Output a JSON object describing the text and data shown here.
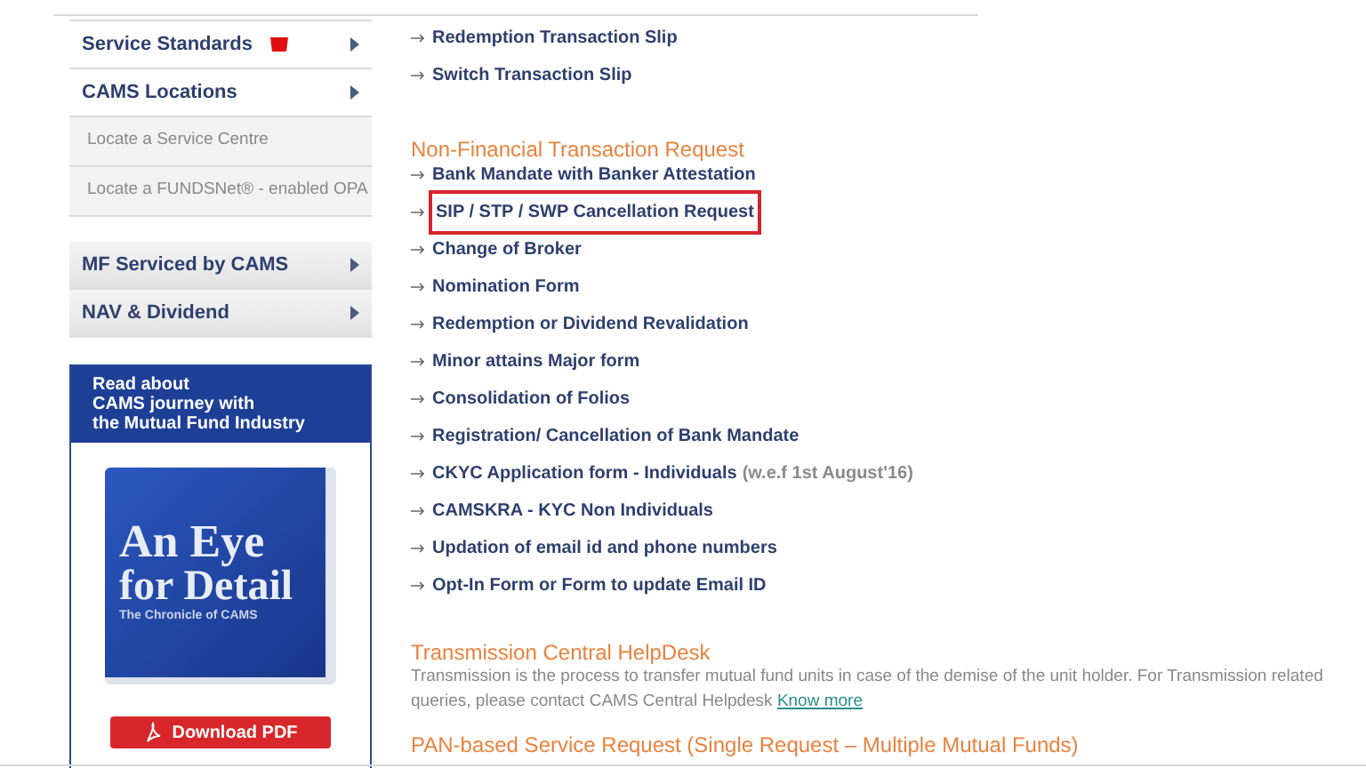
{
  "sidebar": {
    "menu": [
      {
        "label": "Service Standards",
        "kind": "main",
        "flag": true
      },
      {
        "label": "CAMS Locations",
        "kind": "main",
        "flag": false,
        "children": [
          {
            "label": "Locate a Service Centre"
          },
          {
            "label": "Locate a FUNDSNet® - enabled OPA"
          }
        ]
      }
    ],
    "menu2": [
      {
        "label": "MF Serviced by CAMS",
        "kind": "shaded",
        "flag": false
      },
      {
        "label": "NAV & Dividend",
        "kind": "shaded",
        "flag": false
      }
    ],
    "promo": {
      "headline": "Read about\nCAMS journey with\nthe Mutual Fund Industry",
      "book_title_1": "An Eye",
      "book_title_2": "for Detail",
      "book_subtitle": "The Chronicle of CAMS",
      "download": "Download PDF"
    }
  },
  "content": {
    "links_top": [
      {
        "label": "Redemption Transaction Slip",
        "highlighted": false
      },
      {
        "label": "Switch Transaction Slip",
        "highlighted": false
      }
    ],
    "section": {
      "heading": "Non-Financial Transaction Request",
      "links": [
        {
          "label": "Bank Mandate with Banker Attestation",
          "highlighted": false
        },
        {
          "label": "SIP / STP / SWP Cancellation Request",
          "highlighted": true
        },
        {
          "label": "Change of Broker",
          "highlighted": false
        },
        {
          "label": "Nomination Form",
          "highlighted": false
        },
        {
          "label": "Redemption or Dividend Revalidation",
          "highlighted": false
        },
        {
          "label": "Minor attains Major form",
          "highlighted": false
        },
        {
          "label": "Consolidation of Folios",
          "highlighted": false
        },
        {
          "label": "Registration/ Cancellation of Bank Mandate",
          "highlighted": false
        },
        {
          "label": "CKYC Application form - Individuals",
          "note": "(w.e.f 1st August'16)",
          "highlighted": false
        },
        {
          "label": "CAMSKRA - KYC Non Individuals",
          "highlighted": false
        },
        {
          "label": "Updation of email id and phone numbers",
          "highlighted": false
        },
        {
          "label": "Opt-In Form or Form to update Email ID",
          "highlighted": false
        }
      ]
    },
    "transmission": {
      "heading": "Transmission Central HelpDesk",
      "text": "Transmission is the process to transfer mutual fund units in case of the demise of the unit holder. For Transmission related queries, please contact CAMS Central Helpdesk",
      "link": "Know more"
    },
    "pan_heading": "PAN-based Service Request (Single Request – Multiple Mutual Funds)"
  }
}
